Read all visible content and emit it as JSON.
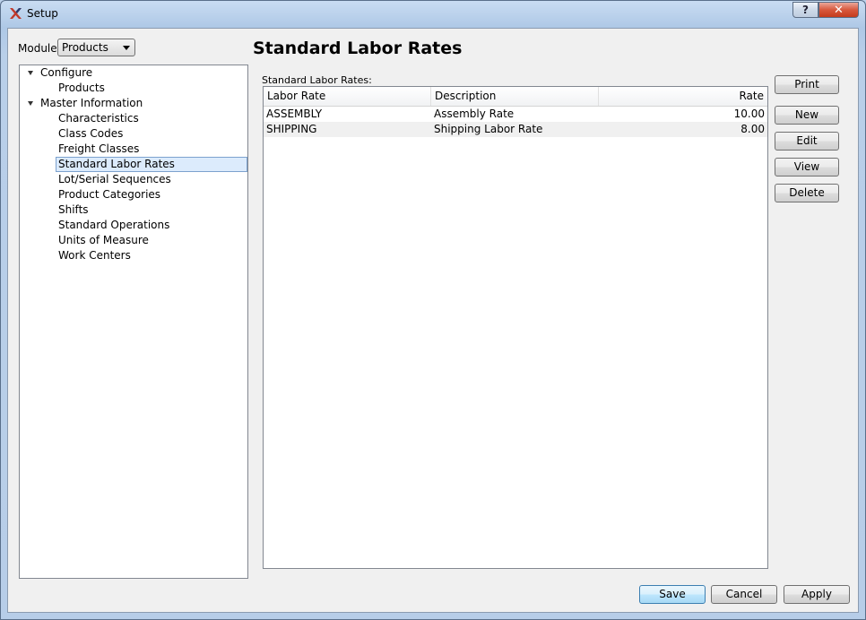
{
  "window": {
    "title": "Setup",
    "help_glyph": "?",
    "close_glyph": "✕",
    "app_icon": "xtuple-x-icon"
  },
  "module": {
    "label": "Module:",
    "selected": "Products"
  },
  "tree": {
    "nodes": [
      {
        "label": "Configure",
        "expanded": true
      },
      {
        "label": "Products"
      },
      {
        "label": "Master Information",
        "expanded": true
      },
      {
        "label": "Characteristics"
      },
      {
        "label": "Class Codes"
      },
      {
        "label": "Freight Classes"
      },
      {
        "label": "Standard Labor Rates",
        "selected": true
      },
      {
        "label": "Lot/Serial Sequences"
      },
      {
        "label": "Product Categories"
      },
      {
        "label": "Shifts"
      },
      {
        "label": "Standard Operations"
      },
      {
        "label": "Units of Measure"
      },
      {
        "label": "Work Centers"
      }
    ]
  },
  "main": {
    "heading": "Standard Labor Rates",
    "grid_label": "Standard Labor Rates:",
    "columns": [
      "Labor Rate",
      "Description",
      "Rate"
    ],
    "rows": [
      [
        "ASSEMBLY",
        "Assembly Rate",
        "10.00"
      ],
      [
        "SHIPPING",
        "Shipping Labor Rate",
        "8.00"
      ]
    ]
  },
  "actions": {
    "print": "Print",
    "new": "New",
    "edit": "Edit",
    "view": "View",
    "delete": "Delete"
  },
  "footer": {
    "save": "Save",
    "cancel": "Cancel",
    "apply": "Apply"
  },
  "colors": {
    "selection": "#dcebfc",
    "frame": "#b9cfe9",
    "close": "#c43b1c"
  }
}
